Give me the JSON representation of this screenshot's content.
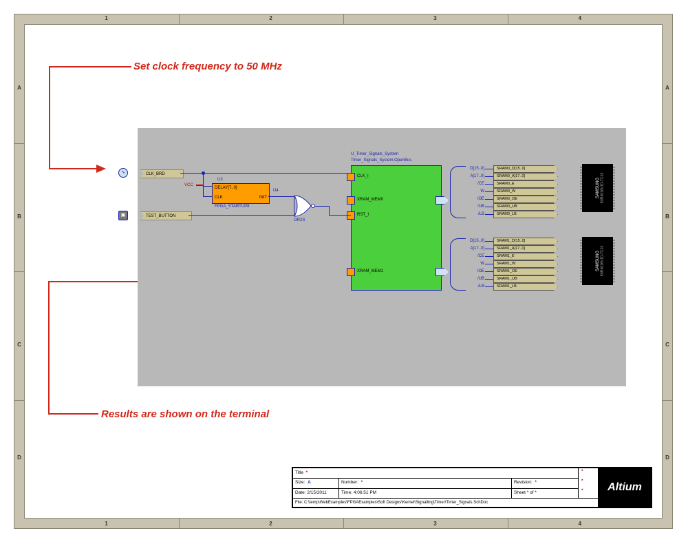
{
  "border": {
    "cols": [
      "1",
      "2",
      "3",
      "4"
    ],
    "rows": [
      "A",
      "B",
      "C",
      "D"
    ]
  },
  "annotations": {
    "top": "Set clock frequency to 50 MHz",
    "bottom": "Results are shown on the terminal"
  },
  "inputs": {
    "clk_brd": "CLK_BRD",
    "test_button": "TEST_BUTTON"
  },
  "fpga": {
    "designator": "U3",
    "delay": "DELAY[7..0]",
    "clk": "CLK",
    "init": "INIT",
    "footprint": "FPGA_STARTUP8",
    "vcc": "VCC",
    "u4": "U4",
    "or_name": "OR2S"
  },
  "system": {
    "designator": "U_Timer_Signals_System",
    "name": "Timer_Signals_System.OpenBus",
    "pins_left": [
      "CLK_I",
      "XRAM_MEM0",
      "RST_I",
      "XRAM_MEM1"
    ]
  },
  "sram": {
    "bus0": {
      "d": "D[15..0]",
      "a": "A[17..0]",
      "ce": "/CE",
      "w": "W",
      "oe": "/OE",
      "ub": "/UB",
      "lb": "/LB"
    },
    "sig0": [
      "SRAM0_D[15..0]",
      "SRAM0_A[17..0]",
      "SRAM0_E",
      "SRAM0_W",
      "SRAM0_OE",
      "SRAM0_UB",
      "SRAM0_LB"
    ],
    "bus1": {
      "d": "D[15..0]",
      "a": "A[17..0]",
      "ce": "/CE",
      "w": "W",
      "oe": "/OE",
      "ub": "/UB",
      "lb": "/LB"
    },
    "sig1": [
      "SRAM1_D[15..0]",
      "SRAM1_A[17..0]",
      "SRAM1_E",
      "SRAM1_W",
      "SRAM1_OE",
      "SRAM1_UB",
      "SRAM1_LB"
    ]
  },
  "chip": {
    "maker": "SAMSUNG",
    "part": "K6R4016V1D-TC10"
  },
  "titleblock": {
    "title_key": "Title",
    "size_key": "Size:",
    "size": "A",
    "number_key": "Number:",
    "rev_key": "Revision:",
    "date_key": "Date:",
    "date": "2/15/2011",
    "time_key": "Time:",
    "time": "4:06:51 PM",
    "sheet_key": "Sheet *   of   *",
    "file_key": "File:",
    "file": "C:\\temp\\WebExamples\\FPGAExamples\\Soft Designs\\Kernel\\Signalling\\Timer\\Timer_Signals.SchDoc",
    "logo": "Altium"
  }
}
